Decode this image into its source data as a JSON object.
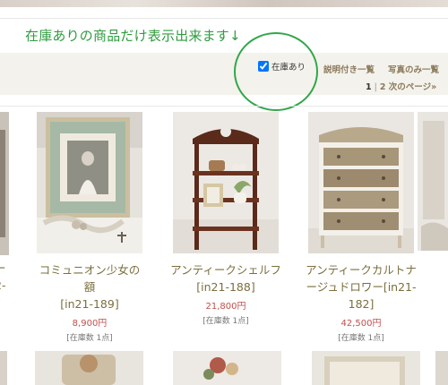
{
  "annotation": {
    "text": "在庫ありの商品だけ表示出来ます↓"
  },
  "toolbar": {
    "stock_filter_label": "在庫あり",
    "stock_filter_checked": true,
    "view_with_description": "説明付き一覧",
    "view_photos_only": "写真のみ一覧",
    "pager": {
      "current": "1",
      "separator": "|",
      "page_link": "2",
      "next_link": "次のページ»"
    }
  },
  "products": [
    {
      "name_line1": "コミュニオン少女の額",
      "name_line2": "[in21-189]",
      "name_line3": "",
      "price": "8,900円",
      "stock": "[在庫数 1点]"
    },
    {
      "name_line1": "アンティークシェルフ",
      "name_line2": "[in21-188]",
      "name_line3": "",
      "price": "21,800円",
      "stock": "[在庫数 1点]"
    },
    {
      "name_line1": "アンティークカルトナ",
      "name_line2": "ージュドロワー[in21-",
      "name_line3": "182]",
      "price": "42,500円",
      "stock": "[在庫数 1点]"
    }
  ],
  "edge_fragments": {
    "left_line1": "ー",
    "left_line2": "2-"
  },
  "colors": {
    "annotation_green": "#2e9c3f",
    "link_brown": "#8a7a5c",
    "price_red": "#c0504d",
    "toolbar_bg": "#f4f2ec"
  }
}
